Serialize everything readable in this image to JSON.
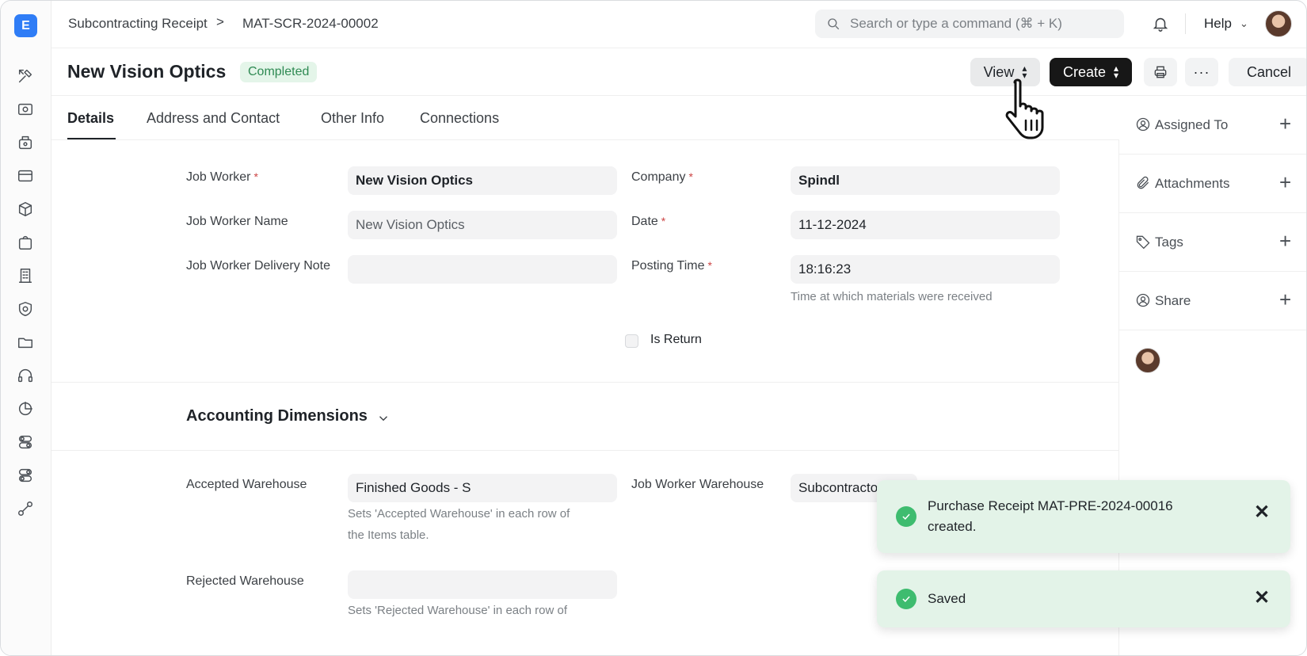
{
  "app": {
    "logo_letter": "E",
    "brand_color": "#2f7df6"
  },
  "breadcrumb": {
    "doctype": "Subcontracting Receipt",
    "separator": ">",
    "record": "MAT-SCR-2024-00002"
  },
  "search": {
    "placeholder": "Search or type a command (⌘ + K)"
  },
  "header": {
    "help_label": "Help"
  },
  "document": {
    "title": "New Vision Optics",
    "status": "Completed",
    "status_color": "#2f8a53",
    "actions": {
      "view": "View",
      "create": "Create",
      "cancel": "Cancel",
      "more": "···"
    }
  },
  "tabs": [
    {
      "label": "Details",
      "active": true
    },
    {
      "label": "Address and Contact"
    },
    {
      "label": "Other Info"
    },
    {
      "label": "Connections"
    }
  ],
  "form": {
    "job_worker": {
      "label": "Job Worker",
      "value": "New Vision Optics"
    },
    "job_worker_name": {
      "label": "Job Worker Name",
      "value": "New Vision Optics"
    },
    "job_worker_delivery_note": {
      "label": "Job Worker Delivery Note",
      "value": ""
    },
    "company": {
      "label": "Company",
      "value": "Spindl"
    },
    "date": {
      "label": "Date",
      "value": "11-12-2024"
    },
    "posting_time": {
      "label": "Posting Time",
      "value": "18:16:23",
      "hint": "Time at which materials were received"
    },
    "is_return": {
      "label": "Is Return",
      "checked": false
    },
    "required_mark": "*"
  },
  "accounting": {
    "title": "Accounting Dimensions",
    "accepted_warehouse": {
      "label": "Accepted Warehouse",
      "value": "Finished Goods - S",
      "hint_line1": "Sets 'Accepted Warehouse' in each row of",
      "hint_line2": "the Items table."
    },
    "job_worker_warehouse": {
      "label": "Job Worker Warehouse",
      "value": "Subcontractor W"
    },
    "rejected_warehouse": {
      "label": "Rejected Warehouse",
      "value": "",
      "hint_line1": "Sets 'Rejected Warehouse' in each row of"
    }
  },
  "sidebar": {
    "assigned_to": "Assigned To",
    "attachments": "Attachments",
    "tags": "Tags",
    "share": "Share",
    "add_symbol": "+"
  },
  "toasts": [
    {
      "line1": "Purchase Receipt MAT-PRE-2024-00016",
      "line2": "created."
    },
    {
      "line1": "Saved"
    }
  ],
  "toast_close": "✕"
}
